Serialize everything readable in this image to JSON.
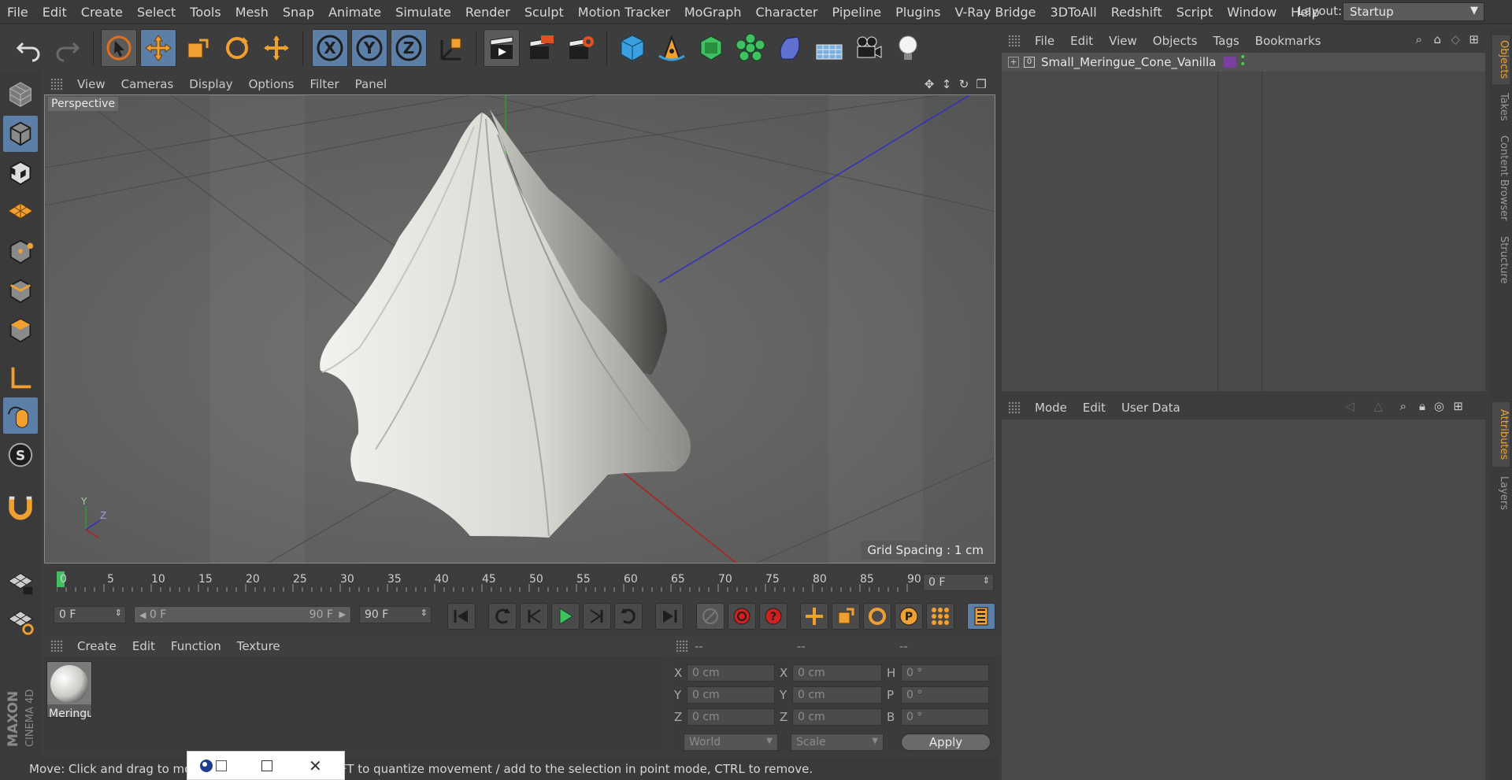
{
  "menubar": {
    "items": [
      "File",
      "Edit",
      "Create",
      "Select",
      "Tools",
      "Mesh",
      "Snap",
      "Animate",
      "Simulate",
      "Render",
      "Sculpt",
      "Motion Tracker",
      "MoGraph",
      "Character",
      "Pipeline",
      "Plugins",
      "V-Ray Bridge",
      "3DToAll",
      "Redshift",
      "Script",
      "Window",
      "Help"
    ],
    "layout_label": "Layout:",
    "layout_value": "Startup"
  },
  "toolbar": {
    "axis_x": "X",
    "axis_y": "Y",
    "axis_z": "Z"
  },
  "viewport": {
    "menu": [
      "View",
      "Cameras",
      "Display",
      "Options",
      "Filter",
      "Panel"
    ],
    "label": "Perspective",
    "grid_spacing": "Grid Spacing : 1 cm",
    "axis_y": "Y",
    "axis_z": "Z"
  },
  "timeline": {
    "ticks": [
      "0",
      "5",
      "10",
      "15",
      "20",
      "25",
      "30",
      "35",
      "40",
      "45",
      "50",
      "55",
      "60",
      "65",
      "70",
      "75",
      "80",
      "85",
      "90"
    ],
    "current_frame": "0 F"
  },
  "transport": {
    "start_field": "0 F",
    "range_start": "0 F",
    "range_end": "90 F",
    "end_field": "90 F"
  },
  "material_manager": {
    "menu": [
      "Create",
      "Edit",
      "Function",
      "Texture"
    ],
    "materials": [
      {
        "name": "Meringu"
      }
    ]
  },
  "coordinates": {
    "col_headers": [
      "--",
      "--",
      "--"
    ],
    "rows": [
      {
        "l1": "X",
        "v1": "0 cm",
        "l2": "X",
        "v2": "0 cm",
        "l3": "H",
        "v3": "0 °"
      },
      {
        "l1": "Y",
        "v1": "0 cm",
        "l2": "Y",
        "v2": "0 cm",
        "l3": "P",
        "v3": "0 °"
      },
      {
        "l1": "Z",
        "v1": "0 cm",
        "l2": "Z",
        "v2": "0 cm",
        "l3": "B",
        "v3": "0 °"
      }
    ],
    "space": "World",
    "mode": "Scale",
    "apply": "Apply"
  },
  "object_manager": {
    "menu": [
      "File",
      "Edit",
      "View",
      "Objects",
      "Tags",
      "Bookmarks"
    ],
    "objects": [
      {
        "name": "Small_Meringue_Cone_Vanilla",
        "tag_color": "#7a3fa0"
      }
    ]
  },
  "attribute_manager": {
    "menu": [
      "Mode",
      "Edit",
      "User Data"
    ]
  },
  "side_tabs": {
    "top": [
      "Objects",
      "Takes",
      "Content Browser",
      "Structure"
    ],
    "bottom": [
      "Attributes",
      "Layers"
    ]
  },
  "brand": {
    "maxon": "MAXON",
    "product": "CINEMA 4D"
  },
  "status": {
    "text": "Move: Click and drag to mo",
    "text_tail": "FT to quantize movement / add to the selection in point mode, CTRL to remove."
  },
  "colors": {
    "accent": "#4e8fd6",
    "active_tool_bg": "#5c7fa8",
    "timeline_marker": "#40c060"
  }
}
